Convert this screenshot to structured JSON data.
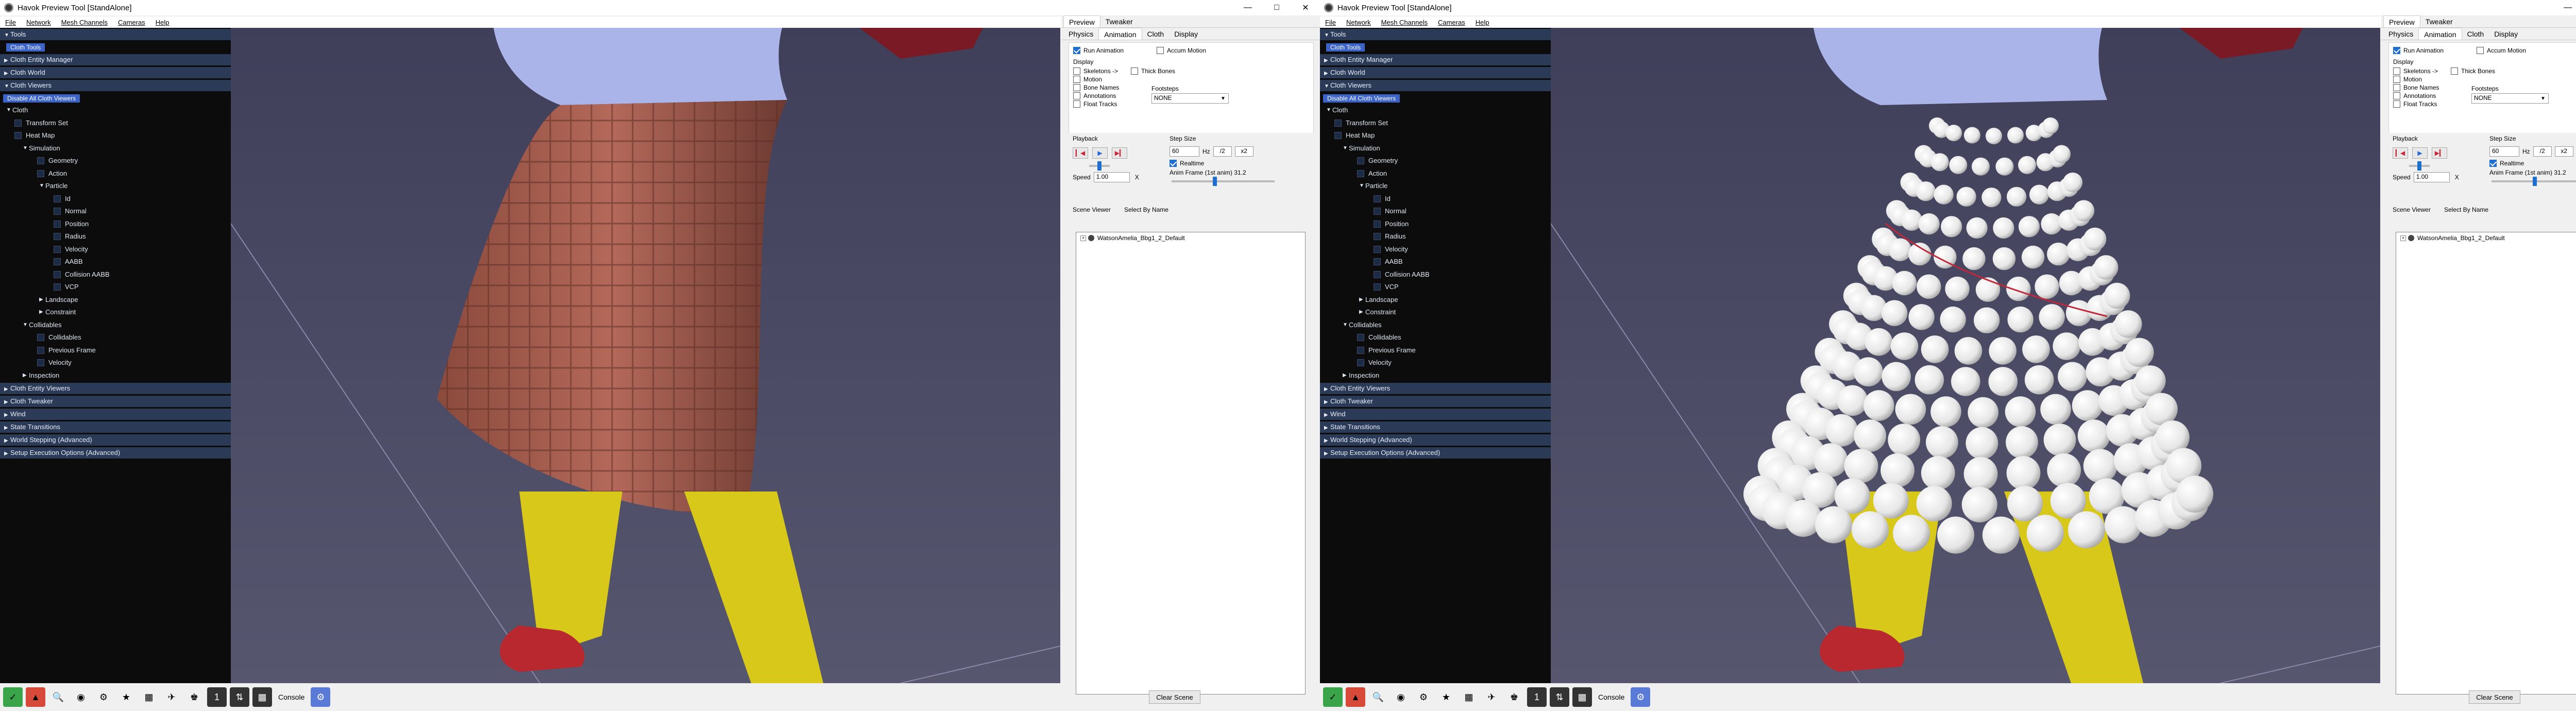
{
  "windows": [
    {
      "id": "left",
      "title": "Havok Preview Tool [StandAlone]",
      "menu": [
        "File",
        "Network",
        "Mesh Channels",
        "Cameras",
        "Help"
      ],
      "left_panel": {
        "tools_label": "Tools",
        "cloth_tools_label": "Cloth Tools",
        "sections_top": [
          "Cloth Entity Manager",
          "Cloth World",
          "Cloth Viewers"
        ],
        "disable_button": "Disable All Cloth Viewers",
        "tree": [
          "Cloth",
          "Transform Set",
          "Heat Map",
          "Simulation",
          "Geometry",
          "Action",
          "Particle",
          "Id",
          "Normal",
          "Position",
          "Radius",
          "Velocity",
          "AABB",
          "Collision AABB",
          "VCP",
          "Landscape",
          "Constraint",
          "Collidables",
          "Collidables",
          "Previous Frame",
          "Velocity",
          "Inspection"
        ],
        "sections_bottom": [
          "Cloth Entity Viewers",
          "Cloth Tweaker",
          "Wind",
          "State Transitions",
          "World Stepping (Advanced)",
          "Setup Execution Options (Advanced)"
        ]
      },
      "viewport": {
        "mode": "cloth-textured"
      },
      "right_panel": {
        "tabs_top": [
          "Preview",
          "Tweaker"
        ],
        "tabs": [
          "Physics",
          "Animation",
          "Cloth",
          "Display"
        ],
        "run_animation": "Run Animation",
        "accum_motion": "Accum Motion",
        "display_label": "Display",
        "display_items": [
          "Skeletons ->",
          "Motion",
          "Bone Names",
          "Annotations",
          "Float Tracks"
        ],
        "thick_bones": "Thick Bones",
        "footsteps_label": "Footsteps",
        "footsteps_value": "NONE",
        "playback_label": "Playback",
        "step_size_label": "Step Size",
        "step_value": "60",
        "hz": "Hz",
        "div2": "/2",
        "mul2": "x2",
        "realtime": "Realtime",
        "speed_label": "Speed",
        "speed_value": "1.00",
        "speed_unit": "X",
        "anim_frame": "Anim Frame (1st anim) 31.2",
        "scene_viewer": "Scene Viewer",
        "select_by_name": "Select By Name",
        "scene_root": "WatsonAmelia_Bbg1_2_Default",
        "clear_scene": "Clear Scene"
      },
      "bottom_console": "Console"
    },
    {
      "id": "right",
      "title": "Havok Preview Tool [StandAlone]",
      "menu": [
        "File",
        "Network",
        "Mesh Channels",
        "Cameras",
        "Help"
      ],
      "left_panel": {
        "tools_label": "Tools",
        "cloth_tools_label": "Cloth Tools",
        "sections_top": [
          "Cloth Entity Manager",
          "Cloth World",
          "Cloth Viewers"
        ],
        "disable_button": "Disable All Cloth Viewers",
        "tree": [
          "Cloth",
          "Transform Set",
          "Heat Map",
          "Simulation",
          "Geometry",
          "Action",
          "Particle",
          "Id",
          "Normal",
          "Position",
          "Radius",
          "Velocity",
          "AABB",
          "Collision AABB",
          "VCP",
          "Landscape",
          "Constraint",
          "Collidables",
          "Collidables",
          "Previous Frame",
          "Velocity",
          "Inspection"
        ],
        "sections_bottom": [
          "Cloth Entity Viewers",
          "Cloth Tweaker",
          "Wind",
          "State Transitions",
          "World Stepping (Advanced)",
          "Setup Execution Options (Advanced)"
        ]
      },
      "viewport": {
        "mode": "particles"
      },
      "right_panel": {
        "tabs_top": [
          "Preview",
          "Tweaker"
        ],
        "tabs": [
          "Physics",
          "Animation",
          "Cloth",
          "Display"
        ],
        "run_animation": "Run Animation",
        "accum_motion": "Accum Motion",
        "display_label": "Display",
        "display_items": [
          "Skeletons ->",
          "Motion",
          "Bone Names",
          "Annotations",
          "Float Tracks"
        ],
        "thick_bones": "Thick Bones",
        "footsteps_label": "Footsteps",
        "footsteps_value": "NONE",
        "playback_label": "Playback",
        "step_size_label": "Step Size",
        "step_value": "60",
        "hz": "Hz",
        "div2": "/2",
        "mul2": "x2",
        "realtime": "Realtime",
        "speed_label": "Speed",
        "speed_value": "1.00",
        "speed_unit": "X",
        "anim_frame": "Anim Frame (1st anim) 31.2",
        "scene_viewer": "Scene Viewer",
        "select_by_name": "Select By Name",
        "scene_root": "WatsonAmelia_Bbg1_2_Default",
        "clear_scene": "Clear Scene"
      },
      "bottom_console": "Console"
    }
  ],
  "colors": {
    "viewport_bg": "#4a4a68",
    "panel_dark": "#0c0c0c",
    "header_blue": "#2b3a57",
    "accent": "#1f6fd1"
  },
  "icons": [
    "app-icon",
    "minimize-icon",
    "maximize-icon",
    "close-icon",
    "play-icon",
    "stop-icon",
    "record-icon"
  ]
}
